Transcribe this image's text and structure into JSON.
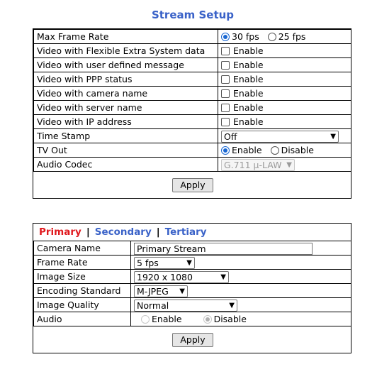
{
  "page": {
    "title": "Stream Setup"
  },
  "setup": {
    "rows": [
      {
        "label": "Max Frame Rate"
      },
      {
        "label": "Video with Flexible Extra System data"
      },
      {
        "label": "Video with user defined message"
      },
      {
        "label": "Video with PPP status"
      },
      {
        "label": "Video with camera name"
      },
      {
        "label": "Video with server name"
      },
      {
        "label": "Video with IP address"
      },
      {
        "label": "Time Stamp"
      },
      {
        "label": "TV Out"
      },
      {
        "label": "Audio Codec"
      }
    ],
    "frame_rate_options": [
      "30 fps",
      "25 fps"
    ],
    "frame_rate_selected": "30 fps",
    "enable_label": "Enable",
    "disable_label": "Disable",
    "time_stamp_value": "Off",
    "tv_out_selected": "Enable",
    "audio_codec_value": "G.711 μ-LAW",
    "apply_label": "Apply"
  },
  "stream": {
    "tabs": [
      "Primary",
      "Secondary",
      "Tertiary"
    ],
    "active_tab": "Primary",
    "tab_separator": "|",
    "rows": [
      {
        "label": "Camera Name"
      },
      {
        "label": "Frame Rate"
      },
      {
        "label": "Image Size"
      },
      {
        "label": "Encoding Standard"
      },
      {
        "label": "Image Quality"
      },
      {
        "label": "Audio"
      }
    ],
    "camera_name_value": "Primary Stream",
    "frame_rate_value": "5 fps",
    "image_size_value": "1920 x 1080",
    "encoding_value": "M-JPEG",
    "image_quality_value": "Normal",
    "audio_enable_label": "Enable",
    "audio_disable_label": "Disable",
    "audio_selected": "Disable",
    "apply_label": "Apply"
  },
  "colors": {
    "title": "#3a62c8",
    "active_tab": "#e0191e",
    "tab": "#3a62c8",
    "radio": "#1967d2"
  }
}
